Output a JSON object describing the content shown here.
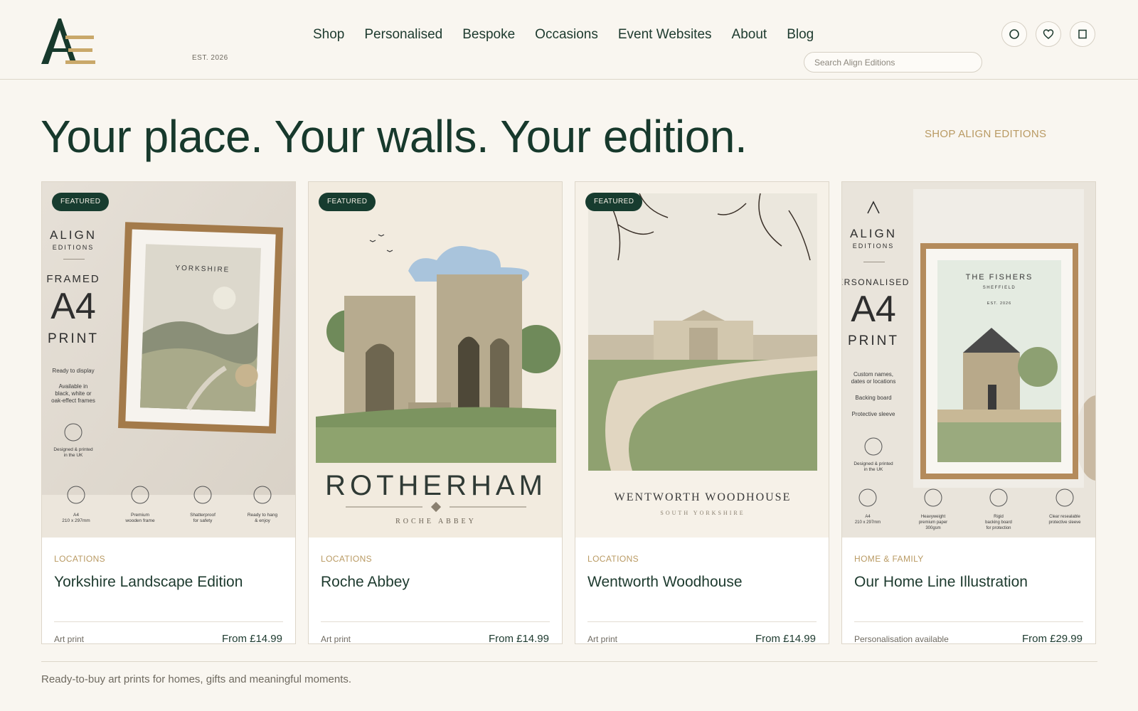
{
  "header": {
    "est_label": "EST. 2026",
    "nav": [
      "Shop",
      "Personalised",
      "Bespoke",
      "Occasions",
      "Event Websites",
      "About",
      "Blog"
    ],
    "search_placeholder": "Search Align Editions"
  },
  "hero": {
    "headline": "Your place. Your walls. Your edition.",
    "shop_link": "SHOP ALIGN EDITIONS"
  },
  "cards": [
    {
      "badge": "FEATURED",
      "category": "LOCATIONS",
      "title": "Yorkshire Landscape Edition",
      "meta": "Art print",
      "price": "From £14.99",
      "image": {
        "brand": "ALIGN",
        "brand_sub": "EDITIONS",
        "line1": "FRAMED",
        "line2": "A4",
        "line3": "PRINT",
        "features": [
          "Ready to display",
          "Available in",
          "black, white or",
          "oak-effect frames"
        ],
        "made": [
          "Designed & printed",
          "in the UK"
        ],
        "print_title": "YORKSHIRE",
        "icons": [
          {
            "icon": "document-icon",
            "label": [
              "A4",
              "210 x 297mm"
            ]
          },
          {
            "icon": "frame-icon",
            "label": [
              "Premium",
              "wooden frame"
            ]
          },
          {
            "icon": "shield-icon",
            "label": [
              "Shatterproof",
              "for safety"
            ]
          },
          {
            "icon": "hook-icon",
            "label": [
              "Ready to hang",
              "& enjoy"
            ]
          }
        ]
      }
    },
    {
      "badge": "FEATURED",
      "category": "LOCATIONS",
      "title": "Roche Abbey",
      "meta": "Art print",
      "price": "From £14.99",
      "image": {
        "place": "ROTHERHAM",
        "sub": "ROCHE ABBEY"
      }
    },
    {
      "badge": "FEATURED",
      "category": "LOCATIONS",
      "title": "Wentworth Woodhouse",
      "meta": "Art print",
      "price": "From £14.99",
      "image": {
        "place": "WENTWORTH WOODHOUSE",
        "sub": "SOUTH YORKSHIRE"
      }
    },
    {
      "badge": "",
      "category": "HOME & FAMILY",
      "title": "Our Home Line Illustration",
      "meta": "Personalisation available",
      "price": "From £29.99",
      "image": {
        "brand": "ALIGN",
        "brand_sub": "EDITIONS",
        "line1": "ERSONALISED",
        "line2": "A4",
        "line3": "PRINT",
        "features": [
          "Custom names,",
          "dates or locations",
          "Backing board",
          "Protective sleeve"
        ],
        "made": [
          "Designed & printed",
          "in the UK"
        ],
        "print_title": "THE FISHERS",
        "print_sub": "SHEFFIELD",
        "print_est": "EST. 2026",
        "icons": [
          {
            "icon": "document-icon",
            "label": [
              "A4",
              "210 x 297mm"
            ]
          },
          {
            "icon": "paper-stack-icon",
            "label": [
              "Heavyweight",
              "premium paper",
              "300gsm"
            ]
          },
          {
            "icon": "board-icon",
            "label": [
              "Rigid",
              "backing board",
              "for protection"
            ]
          },
          {
            "icon": "shield-icon",
            "label": [
              "Clear resealable",
              "protective sleeve"
            ]
          }
        ]
      }
    }
  ],
  "footer": {
    "text": "Ready-to-buy art prints for homes, gifts and meaningful moments."
  },
  "colors": {
    "accent": "#173c2f",
    "gold": "#b99a63",
    "background": "#f9f6f0"
  }
}
